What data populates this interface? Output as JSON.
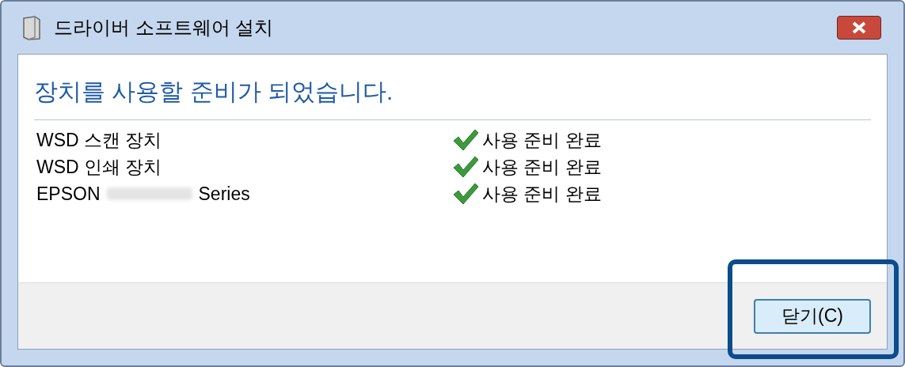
{
  "window": {
    "title": "드라이버 소프트웨어 설치"
  },
  "heading": "장치를 사용할 준비가 되었습니다.",
  "devices": [
    {
      "kind": "plain",
      "name": "WSD 스캔 장치",
      "status": "사용 준비 완료"
    },
    {
      "kind": "plain",
      "name": "WSD 인쇄 장치",
      "status": "사용 준비 완료"
    },
    {
      "kind": "redacted",
      "name": "EPSON",
      "suffix": "Series",
      "status": "사용 준비 완료"
    }
  ],
  "close_button": {
    "label": "닫기(C)",
    "highlighted": true
  }
}
